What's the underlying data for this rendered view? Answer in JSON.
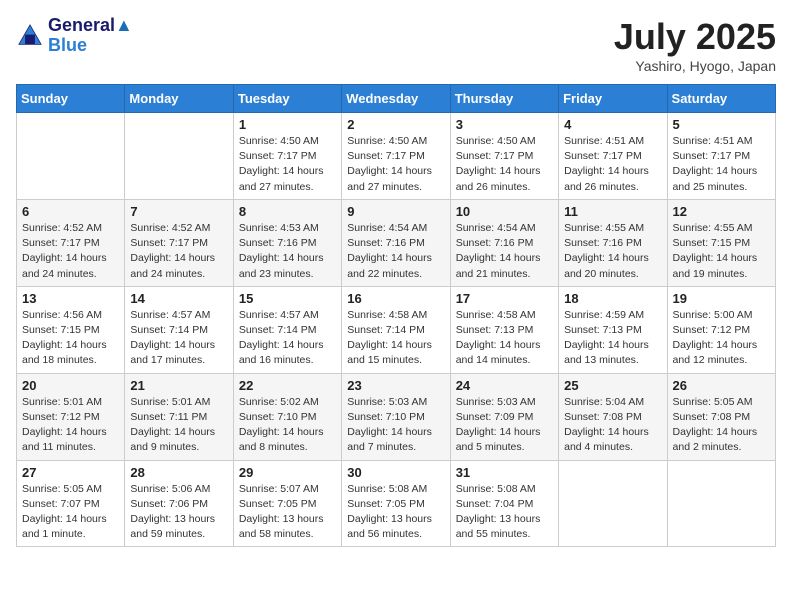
{
  "header": {
    "logo_line1": "General",
    "logo_line2": "Blue",
    "month_title": "July 2025",
    "location": "Yashiro, Hyogo, Japan"
  },
  "days_of_week": [
    "Sunday",
    "Monday",
    "Tuesday",
    "Wednesday",
    "Thursday",
    "Friday",
    "Saturday"
  ],
  "weeks": [
    [
      {
        "day": "",
        "info": ""
      },
      {
        "day": "",
        "info": ""
      },
      {
        "day": "1",
        "info": "Sunrise: 4:50 AM\nSunset: 7:17 PM\nDaylight: 14 hours and 27 minutes."
      },
      {
        "day": "2",
        "info": "Sunrise: 4:50 AM\nSunset: 7:17 PM\nDaylight: 14 hours and 27 minutes."
      },
      {
        "day": "3",
        "info": "Sunrise: 4:50 AM\nSunset: 7:17 PM\nDaylight: 14 hours and 26 minutes."
      },
      {
        "day": "4",
        "info": "Sunrise: 4:51 AM\nSunset: 7:17 PM\nDaylight: 14 hours and 26 minutes."
      },
      {
        "day": "5",
        "info": "Sunrise: 4:51 AM\nSunset: 7:17 PM\nDaylight: 14 hours and 25 minutes."
      }
    ],
    [
      {
        "day": "6",
        "info": "Sunrise: 4:52 AM\nSunset: 7:17 PM\nDaylight: 14 hours and 24 minutes."
      },
      {
        "day": "7",
        "info": "Sunrise: 4:52 AM\nSunset: 7:17 PM\nDaylight: 14 hours and 24 minutes."
      },
      {
        "day": "8",
        "info": "Sunrise: 4:53 AM\nSunset: 7:16 PM\nDaylight: 14 hours and 23 minutes."
      },
      {
        "day": "9",
        "info": "Sunrise: 4:54 AM\nSunset: 7:16 PM\nDaylight: 14 hours and 22 minutes."
      },
      {
        "day": "10",
        "info": "Sunrise: 4:54 AM\nSunset: 7:16 PM\nDaylight: 14 hours and 21 minutes."
      },
      {
        "day": "11",
        "info": "Sunrise: 4:55 AM\nSunset: 7:16 PM\nDaylight: 14 hours and 20 minutes."
      },
      {
        "day": "12",
        "info": "Sunrise: 4:55 AM\nSunset: 7:15 PM\nDaylight: 14 hours and 19 minutes."
      }
    ],
    [
      {
        "day": "13",
        "info": "Sunrise: 4:56 AM\nSunset: 7:15 PM\nDaylight: 14 hours and 18 minutes."
      },
      {
        "day": "14",
        "info": "Sunrise: 4:57 AM\nSunset: 7:14 PM\nDaylight: 14 hours and 17 minutes."
      },
      {
        "day": "15",
        "info": "Sunrise: 4:57 AM\nSunset: 7:14 PM\nDaylight: 14 hours and 16 minutes."
      },
      {
        "day": "16",
        "info": "Sunrise: 4:58 AM\nSunset: 7:14 PM\nDaylight: 14 hours and 15 minutes."
      },
      {
        "day": "17",
        "info": "Sunrise: 4:58 AM\nSunset: 7:13 PM\nDaylight: 14 hours and 14 minutes."
      },
      {
        "day": "18",
        "info": "Sunrise: 4:59 AM\nSunset: 7:13 PM\nDaylight: 14 hours and 13 minutes."
      },
      {
        "day": "19",
        "info": "Sunrise: 5:00 AM\nSunset: 7:12 PM\nDaylight: 14 hours and 12 minutes."
      }
    ],
    [
      {
        "day": "20",
        "info": "Sunrise: 5:01 AM\nSunset: 7:12 PM\nDaylight: 14 hours and 11 minutes."
      },
      {
        "day": "21",
        "info": "Sunrise: 5:01 AM\nSunset: 7:11 PM\nDaylight: 14 hours and 9 minutes."
      },
      {
        "day": "22",
        "info": "Sunrise: 5:02 AM\nSunset: 7:10 PM\nDaylight: 14 hours and 8 minutes."
      },
      {
        "day": "23",
        "info": "Sunrise: 5:03 AM\nSunset: 7:10 PM\nDaylight: 14 hours and 7 minutes."
      },
      {
        "day": "24",
        "info": "Sunrise: 5:03 AM\nSunset: 7:09 PM\nDaylight: 14 hours and 5 minutes."
      },
      {
        "day": "25",
        "info": "Sunrise: 5:04 AM\nSunset: 7:08 PM\nDaylight: 14 hours and 4 minutes."
      },
      {
        "day": "26",
        "info": "Sunrise: 5:05 AM\nSunset: 7:08 PM\nDaylight: 14 hours and 2 minutes."
      }
    ],
    [
      {
        "day": "27",
        "info": "Sunrise: 5:05 AM\nSunset: 7:07 PM\nDaylight: 14 hours and 1 minute."
      },
      {
        "day": "28",
        "info": "Sunrise: 5:06 AM\nSunset: 7:06 PM\nDaylight: 13 hours and 59 minutes."
      },
      {
        "day": "29",
        "info": "Sunrise: 5:07 AM\nSunset: 7:05 PM\nDaylight: 13 hours and 58 minutes."
      },
      {
        "day": "30",
        "info": "Sunrise: 5:08 AM\nSunset: 7:05 PM\nDaylight: 13 hours and 56 minutes."
      },
      {
        "day": "31",
        "info": "Sunrise: 5:08 AM\nSunset: 7:04 PM\nDaylight: 13 hours and 55 minutes."
      },
      {
        "day": "",
        "info": ""
      },
      {
        "day": "",
        "info": ""
      }
    ]
  ]
}
